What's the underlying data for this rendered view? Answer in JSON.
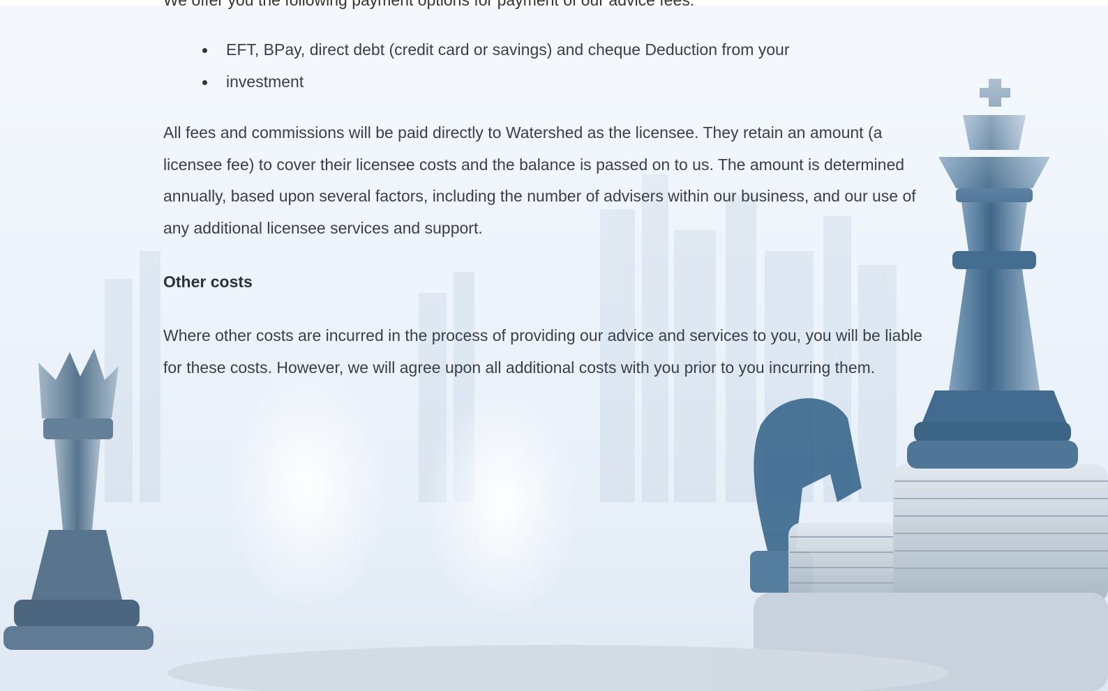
{
  "document": {
    "cut_off_line": "We offer you the following payment options for payment of our advice fees:",
    "bullets": [
      "EFT, BPay, direct debt (credit card or savings) and cheque Deduction from your",
      "investment"
    ],
    "paragraph_fees": "All fees and commissions will be paid directly to Watershed as the licensee. They retain an amount (a licensee fee) to cover their licensee costs and the balance is passed on to us. The amount is determined annually, based upon several factors, including the number of advisers within our business, and our use of any additional licensee services and support.",
    "heading_other_costs": "Other costs",
    "paragraph_other_costs": "Where other costs are incurred in the process of providing our advice and services to you, you will be liable for these costs. However, we will agree upon all additional costs with you prior to you incurring them."
  },
  "background": {
    "description_colors": {
      "sky": "#eef4fb",
      "chess_blue": "#3f6a8f",
      "coin_silver": "#c9d3dd"
    }
  }
}
